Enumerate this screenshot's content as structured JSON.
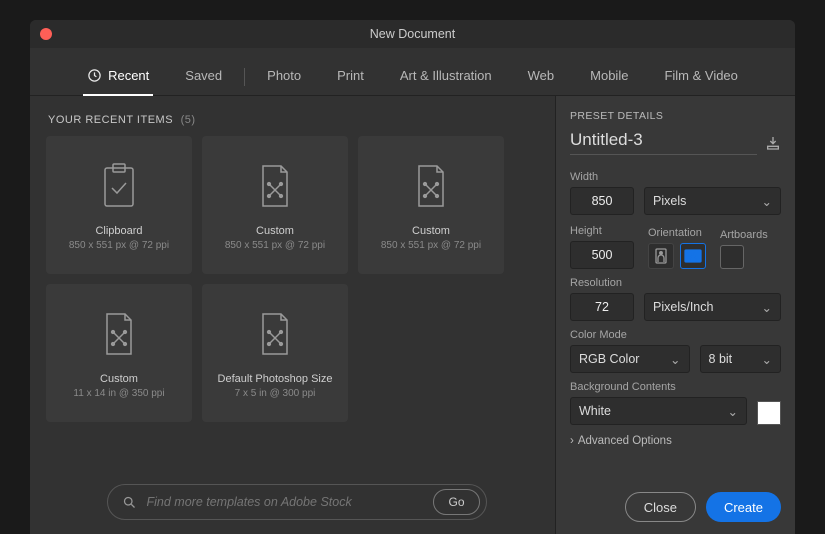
{
  "window": {
    "title": "New Document"
  },
  "tabs": {
    "recent": "Recent",
    "saved": "Saved",
    "photo": "Photo",
    "print": "Print",
    "art": "Art & Illustration",
    "web": "Web",
    "mobile": "Mobile",
    "film": "Film & Video"
  },
  "recent": {
    "header": "YOUR RECENT ITEMS",
    "count": "(5)",
    "cards": [
      {
        "title": "Clipboard",
        "sub": "850 x 551 px @ 72 ppi"
      },
      {
        "title": "Custom",
        "sub": "850 x 551 px @ 72 ppi"
      },
      {
        "title": "Custom",
        "sub": "850 x 551 px @ 72 ppi"
      },
      {
        "title": "Custom",
        "sub": "11 x 14 in @ 350 ppi"
      },
      {
        "title": "Default Photoshop Size",
        "sub": "7 x 5 in @ 300 ppi"
      }
    ]
  },
  "search": {
    "placeholder": "Find more templates on Adobe Stock",
    "go": "Go"
  },
  "preset": {
    "heading": "PRESET DETAILS",
    "name": "Untitled-3",
    "width_label": "Width",
    "width_value": "850",
    "unit": "Pixels",
    "height_label": "Height",
    "height_value": "500",
    "orientation_label": "Orientation",
    "artboards_label": "Artboards",
    "resolution_label": "Resolution",
    "resolution_value": "72",
    "resolution_unit": "Pixels/Inch",
    "colormode_label": "Color Mode",
    "colormode_value": "RGB Color",
    "bitdepth": "8 bit",
    "bg_label": "Background Contents",
    "bg_value": "White",
    "advanced": "Advanced Options",
    "close": "Close",
    "create": "Create"
  }
}
